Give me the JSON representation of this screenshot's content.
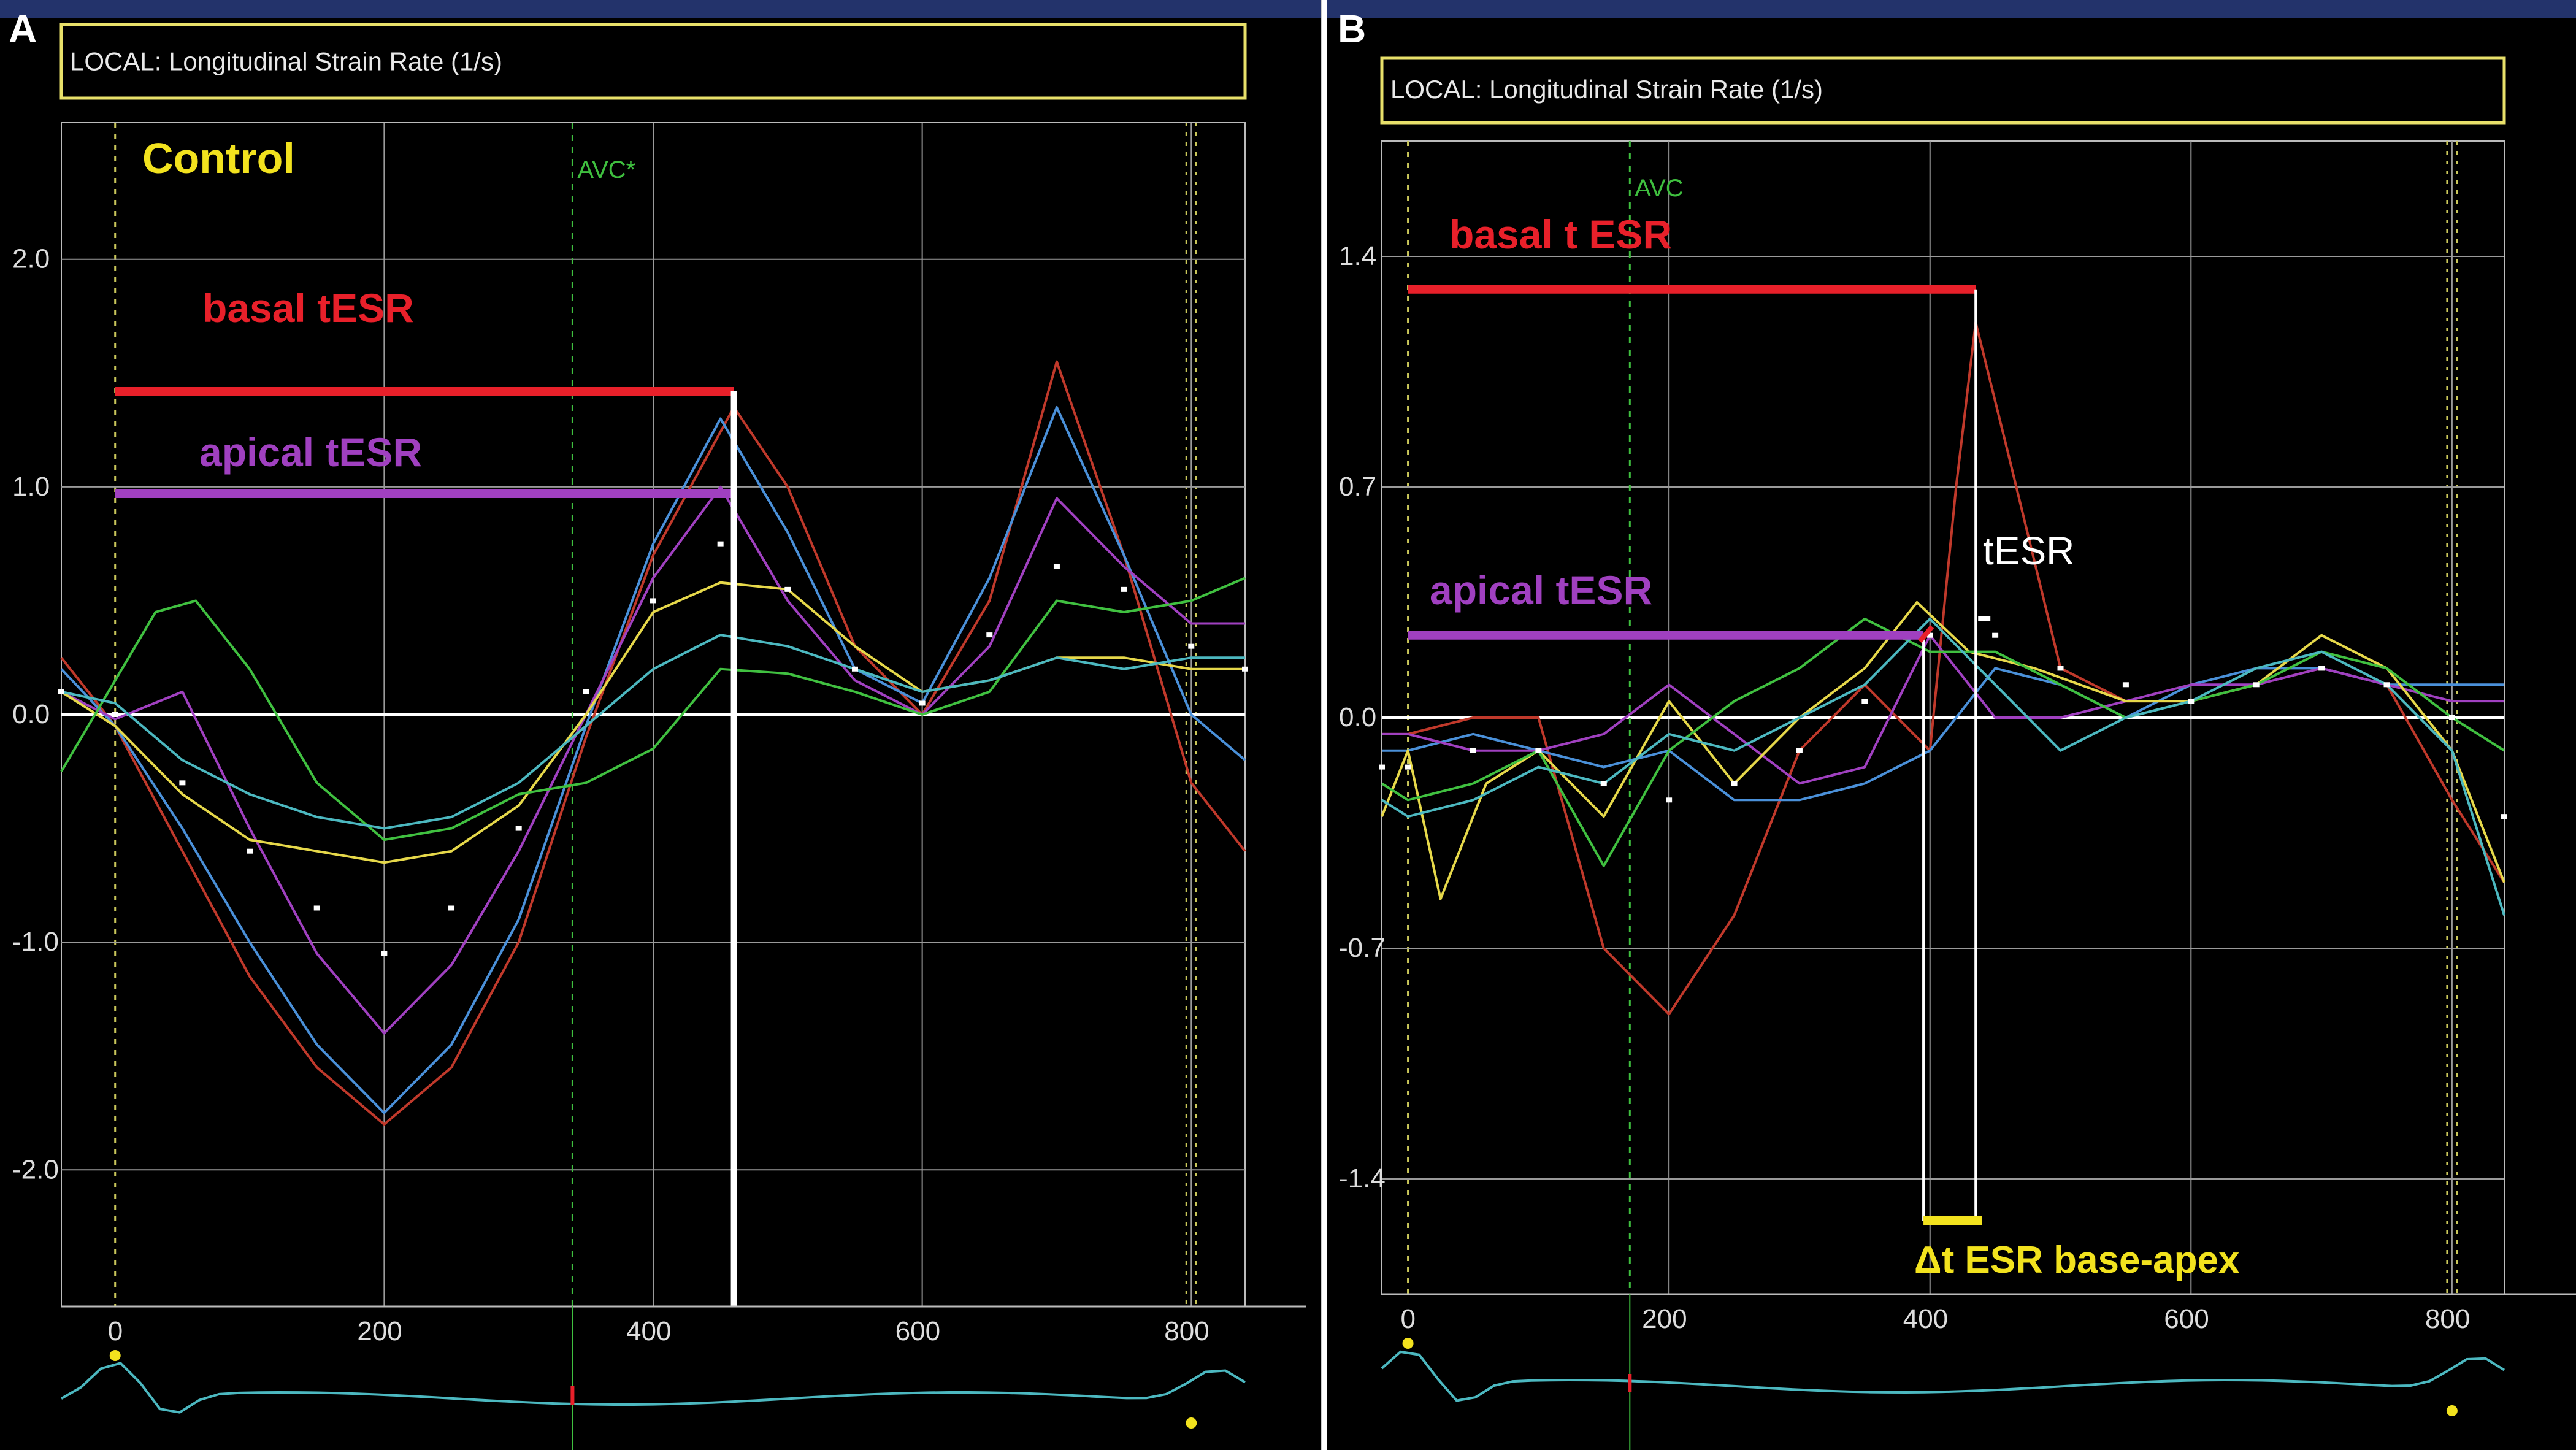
{
  "chart_data": [
    {
      "id": "A",
      "type": "line",
      "panel_label": "A",
      "header": "LOCAL: Longitudinal Strain Rate (1/s)",
      "group_label": "Control",
      "event_label": "AVC*",
      "event_x": 340,
      "x_ticks": [
        0,
        200,
        400,
        600,
        800
      ],
      "y_ticks": [
        2.0,
        1.0,
        0.0,
        -1.0,
        -2.0
      ],
      "xlim": [
        -40,
        840
      ],
      "ylim": [
        -2.6,
        2.6
      ],
      "grid": true,
      "annotations": [
        {
          "label": "basal tESR",
          "color": "#e8202a",
          "y": 1.42,
          "x_start": 0,
          "x_end": 460
        },
        {
          "label": "apical  tESR",
          "color": "#a040c0",
          "y": 0.97,
          "x_start": 0,
          "x_end": 460
        }
      ],
      "time_marker_x": 460,
      "series": [
        {
          "color": "#c0392b",
          "x": [
            -40,
            0,
            50,
            100,
            150,
            200,
            250,
            300,
            350,
            400,
            460,
            500,
            550,
            600,
            650,
            700,
            750,
            800,
            840
          ],
          "y": [
            0.25,
            -0.05,
            -0.6,
            -1.15,
            -1.55,
            -1.8,
            -1.55,
            -1.0,
            -0.1,
            0.7,
            1.35,
            1.0,
            0.3,
            0.0,
            0.5,
            1.55,
            0.7,
            -0.3,
            -0.6
          ]
        },
        {
          "color": "#4a90d9",
          "x": [
            -40,
            0,
            50,
            100,
            150,
            200,
            250,
            300,
            350,
            400,
            450,
            500,
            550,
            600,
            650,
            700,
            750,
            800,
            840
          ],
          "y": [
            0.2,
            -0.05,
            -0.5,
            -1.0,
            -1.45,
            -1.75,
            -1.45,
            -0.9,
            -0.05,
            0.75,
            1.3,
            0.8,
            0.2,
            0.05,
            0.6,
            1.35,
            0.7,
            0.0,
            -0.2
          ]
        },
        {
          "color": "#a040c0",
          "x": [
            -40,
            0,
            50,
            100,
            150,
            200,
            250,
            300,
            350,
            400,
            450,
            500,
            550,
            600,
            650,
            700,
            750,
            800,
            840
          ],
          "y": [
            0.1,
            -0.02,
            0.1,
            -0.5,
            -1.05,
            -1.4,
            -1.1,
            -0.6,
            0.0,
            0.6,
            1.0,
            0.5,
            0.15,
            0.0,
            0.3,
            0.95,
            0.65,
            0.4,
            0.4
          ]
        },
        {
          "color": "#e6d84a",
          "x": [
            -40,
            0,
            50,
            100,
            150,
            200,
            250,
            300,
            350,
            400,
            450,
            500,
            550,
            600,
            650,
            700,
            750,
            800,
            840
          ],
          "y": [
            0.1,
            -0.05,
            -0.35,
            -0.55,
            -0.6,
            -0.65,
            -0.6,
            -0.4,
            0.0,
            0.45,
            0.58,
            0.55,
            0.3,
            0.1,
            0.15,
            0.25,
            0.25,
            0.2,
            0.2
          ]
        },
        {
          "color": "#40c040",
          "x": [
            -40,
            0,
            30,
            60,
            100,
            150,
            200,
            250,
            300,
            350,
            400,
            450,
            500,
            550,
            600,
            650,
            700,
            750,
            800,
            840
          ],
          "y": [
            -0.25,
            0.15,
            0.45,
            0.5,
            0.2,
            -0.3,
            -0.55,
            -0.5,
            -0.35,
            -0.3,
            -0.15,
            0.2,
            0.18,
            0.1,
            0.0,
            0.1,
            0.5,
            0.45,
            0.5,
            0.6
          ]
        },
        {
          "color": "#4cb8c0",
          "x": [
            -40,
            0,
            50,
            100,
            150,
            200,
            250,
            300,
            350,
            400,
            450,
            500,
            550,
            600,
            650,
            700,
            750,
            800,
            840
          ],
          "y": [
            0.1,
            0.05,
            -0.2,
            -0.35,
            -0.45,
            -0.5,
            -0.45,
            -0.3,
            -0.05,
            0.2,
            0.35,
            0.3,
            0.2,
            0.1,
            0.15,
            0.25,
            0.2,
            0.25,
            0.25
          ]
        },
        {
          "color": "#ffffff",
          "dotted": true,
          "x": [
            -40,
            0,
            50,
            100,
            150,
            200,
            250,
            300,
            350,
            400,
            450,
            500,
            550,
            600,
            650,
            700,
            750,
            800,
            840
          ],
          "y": [
            0.1,
            0.0,
            -0.3,
            -0.6,
            -0.85,
            -1.05,
            -0.85,
            -0.5,
            0.1,
            0.5,
            0.75,
            0.55,
            0.2,
            0.05,
            0.35,
            0.65,
            0.55,
            0.3,
            0.2
          ]
        }
      ]
    },
    {
      "id": "B",
      "type": "line",
      "panel_label": "B",
      "header": "LOCAL: Longitudinal Strain Rate (1/s)",
      "event_label": "AVC",
      "event_x": 170,
      "x_ticks": [
        0,
        200,
        400,
        600,
        800
      ],
      "y_ticks": [
        1.4,
        0.7,
        0.0,
        -0.7,
        -1.4
      ],
      "xlim": [
        -20,
        840
      ],
      "ylim": [
        -1.75,
        1.75
      ],
      "grid": true,
      "annotations": [
        {
          "label": "basal t ESR",
          "color": "#e8202a",
          "y": 1.3,
          "x_start": 0,
          "x_end": 435
        },
        {
          "label": "apical  tESR",
          "color": "#a040c0",
          "y": 0.25,
          "x_start": 0,
          "x_end": 395
        }
      ],
      "peak_label": "tESR",
      "delta_label": "Δt ESR base-apex",
      "delta_range": [
        395,
        435
      ],
      "series": [
        {
          "color": "#c0392b",
          "x": [
            -20,
            0,
            50,
            100,
            150,
            200,
            250,
            300,
            350,
            400,
            420,
            435,
            460,
            500,
            550,
            600,
            650,
            700,
            750,
            800,
            840
          ],
          "y": [
            -0.05,
            -0.05,
            0.0,
            0.0,
            -0.7,
            -0.9,
            -0.6,
            -0.1,
            0.1,
            -0.1,
            0.7,
            1.2,
            0.8,
            0.15,
            0.05,
            0.05,
            0.1,
            0.15,
            0.1,
            -0.25,
            -0.5
          ]
        },
        {
          "color": "#4a90d9",
          "x": [
            -20,
            0,
            50,
            100,
            150,
            200,
            250,
            300,
            350,
            400,
            450,
            500,
            550,
            600,
            650,
            700,
            750,
            800,
            840
          ],
          "y": [
            -0.1,
            -0.1,
            -0.05,
            -0.1,
            -0.15,
            -0.1,
            -0.25,
            -0.25,
            -0.2,
            -0.1,
            0.15,
            0.1,
            0.0,
            0.1,
            0.15,
            0.15,
            0.1,
            0.1,
            0.1
          ]
        },
        {
          "color": "#a040c0",
          "x": [
            -20,
            0,
            50,
            100,
            150,
            200,
            250,
            300,
            350,
            400,
            450,
            500,
            550,
            600,
            650,
            700,
            750,
            800,
            840
          ],
          "y": [
            -0.05,
            -0.05,
            -0.1,
            -0.1,
            -0.05,
            0.1,
            -0.05,
            -0.2,
            -0.15,
            0.25,
            0.0,
            0.0,
            0.05,
            0.1,
            0.1,
            0.15,
            0.1,
            0.05,
            0.05
          ]
        },
        {
          "color": "#e6d84a",
          "x": [
            -20,
            0,
            25,
            60,
            100,
            150,
            200,
            250,
            300,
            350,
            390,
            430,
            480,
            550,
            600,
            650,
            700,
            750,
            800,
            840
          ],
          "y": [
            -0.3,
            -0.1,
            -0.55,
            -0.2,
            -0.1,
            -0.3,
            0.05,
            -0.2,
            0.0,
            0.15,
            0.35,
            0.2,
            0.15,
            0.05,
            0.05,
            0.1,
            0.25,
            0.15,
            -0.1,
            -0.5
          ]
        },
        {
          "color": "#40c040",
          "x": [
            -20,
            0,
            50,
            100,
            150,
            200,
            250,
            300,
            350,
            400,
            450,
            500,
            550,
            600,
            650,
            700,
            750,
            800,
            840
          ],
          "y": [
            -0.2,
            -0.25,
            -0.2,
            -0.1,
            -0.45,
            -0.1,
            0.05,
            0.15,
            0.3,
            0.2,
            0.2,
            0.1,
            0.0,
            0.05,
            0.1,
            0.2,
            0.15,
            0.0,
            -0.1
          ]
        },
        {
          "color": "#4cb8c0",
          "x": [
            -20,
            0,
            50,
            100,
            150,
            200,
            250,
            300,
            350,
            400,
            450,
            500,
            550,
            600,
            650,
            700,
            750,
            800,
            840
          ],
          "y": [
            -0.25,
            -0.3,
            -0.25,
            -0.15,
            -0.2,
            -0.05,
            -0.1,
            0.0,
            0.1,
            0.3,
            0.1,
            -0.1,
            0.0,
            0.05,
            0.15,
            0.2,
            0.1,
            -0.1,
            -0.6
          ]
        },
        {
          "color": "#ffffff",
          "dotted": true,
          "x": [
            -20,
            0,
            50,
            100,
            150,
            200,
            250,
            300,
            350,
            400,
            450,
            500,
            550,
            600,
            650,
            700,
            750,
            800,
            840
          ],
          "y": [
            -0.15,
            -0.15,
            -0.1,
            -0.1,
            -0.2,
            -0.25,
            -0.2,
            -0.1,
            0.05,
            0.25,
            0.25,
            0.15,
            0.1,
            0.05,
            0.1,
            0.15,
            0.1,
            0.0,
            -0.3
          ]
        }
      ]
    }
  ]
}
